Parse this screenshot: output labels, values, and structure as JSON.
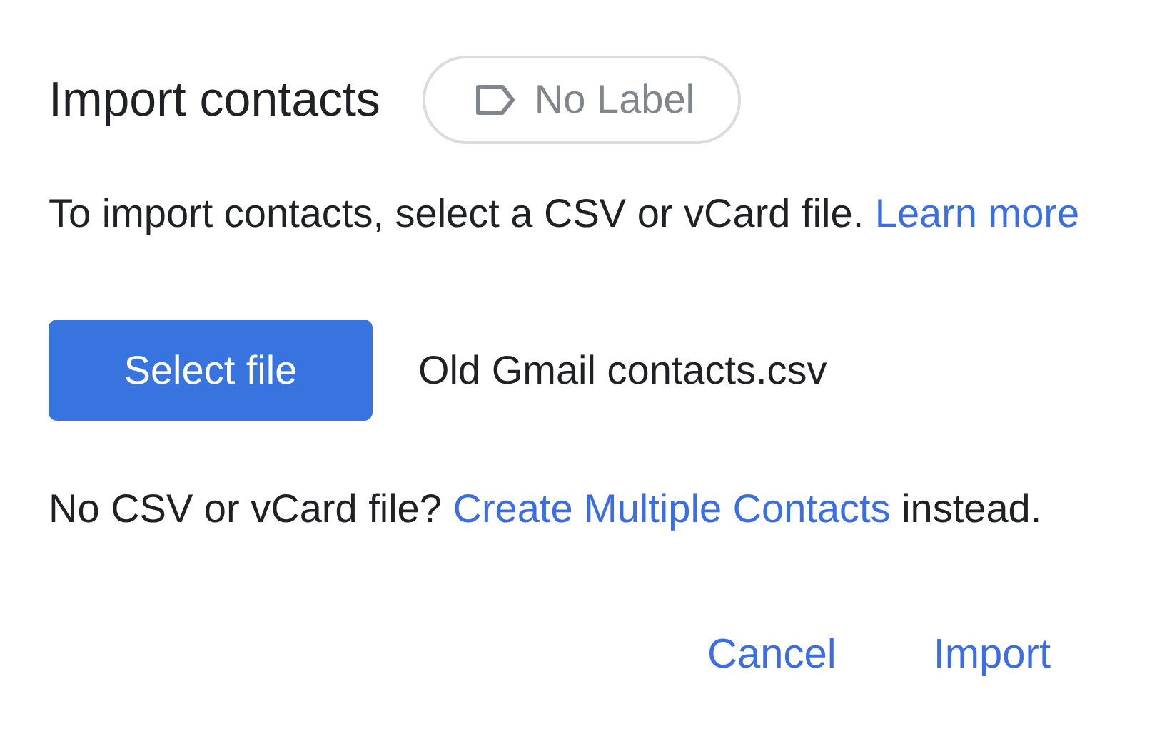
{
  "dialog": {
    "title": "Import contacts",
    "label_chip": {
      "text": "No Label"
    },
    "intro": {
      "before": "To import contacts, select a CSV or vCard file. ",
      "link": "Learn more"
    },
    "file_picker": {
      "button": "Select file",
      "file_name": "Old Gmail contacts.csv"
    },
    "alternative": {
      "before": "No CSV or vCard file? ",
      "link": "Create Multiple Contacts",
      "after": " instead."
    },
    "actions": [
      "Cancel",
      "Import"
    ]
  }
}
